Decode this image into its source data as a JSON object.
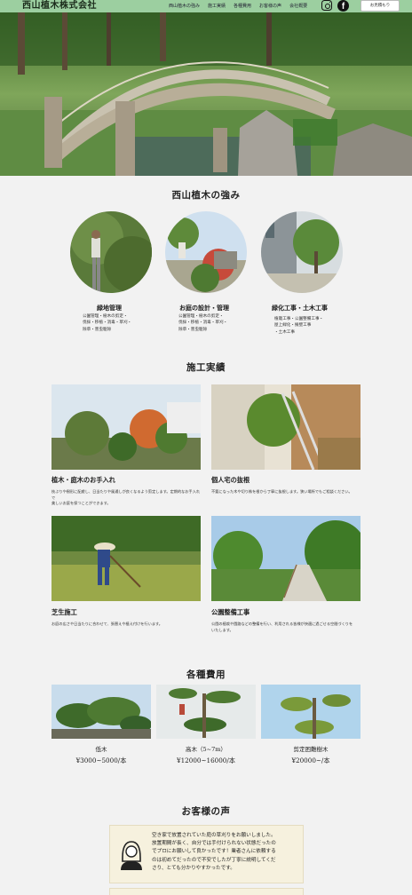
{
  "header": {
    "logo": "西山植木株式会社",
    "nav": [
      "西山植木の強み",
      "施工実績",
      "各種費用",
      "お客様の声",
      "会社概要"
    ],
    "quote_button": "お見積もり",
    "icons": [
      "instagram-icon",
      "facebook-icon"
    ]
  },
  "strengths": {
    "title": "西山植木の強み",
    "items": [
      {
        "title": "緑地管理",
        "desc": "公園管理・樹木の剪定・\n伐採・移植・消毒・草刈・\n除草・害虫駆除"
      },
      {
        "title": "お庭の設計・管理",
        "desc": "公園管理・樹木の剪定・\n伐採・移植・消毒・草刈・\n除草・害虫駆除"
      },
      {
        "title": "緑化工事・土木工事",
        "desc": "植栽工事・公園整備工事・\n屋上緑化・擁壁工事\n・土木工事"
      }
    ]
  },
  "works": {
    "title": "施工実績",
    "items": [
      {
        "title": "植木・庭木のお手入れ",
        "desc": "枝ぶりや樹形に配慮し、日当たりや風通しが良くなるよう剪定します。定期的なお手入れで\n美しいお庭を保つことができます。"
      },
      {
        "title": "個人宅の抜根",
        "desc": "不要になった木や切り株を根から丁寧に抜根します。狭い場所でもご相談ください。"
      },
      {
        "title": "芝生施工",
        "desc": "お庭の広さや日当たりに合わせて、張替えや植え付けを行います。"
      },
      {
        "title": "公園整備工事",
        "desc": "公園の植栽や園路などの整備を行い、利用される皆様が快適に過ごせる空間づくりを\nいたします。"
      }
    ]
  },
  "pricing": {
    "title": "各種費用",
    "items": [
      {
        "name": "低木",
        "price": "¥3000~5000/本"
      },
      {
        "name": "高木（5~7m）",
        "price": "¥12000~16000/本"
      },
      {
        "name": "剪定困難樹木",
        "price": "¥20000~/本"
      }
    ]
  },
  "voices": {
    "title": "お客様の声",
    "items": [
      {
        "text": "空き家で放置されていた庭の草刈りをお願いしました。\n放置期間が長く、自分では手付けられない状態だったの\nでプロにお願いして良かったです！業者さんに依頼する\nのは初めてだったので不安でしたが丁寧に説明してくだ\nさり、とても分かりやすかったです。"
      }
    ]
  },
  "colors": {
    "header_bg": "#9ccfa0",
    "page_bg": "#f2f2f2",
    "voice_bg": "#f6f1de"
  }
}
